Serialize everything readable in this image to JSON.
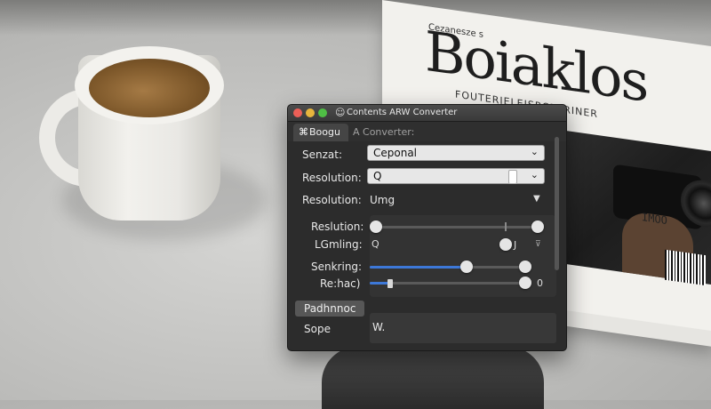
{
  "background": {
    "book": {
      "kicker": "Cezanesze s",
      "title": "Boiaklos",
      "subtitle": "FOUTERIELEISRCEPRINER",
      "side_text": "IMOO"
    }
  },
  "window": {
    "title": "Contents ARW Converter",
    "tabs": [
      {
        "label": "Boogu",
        "icon": "app-icon",
        "active": true
      },
      {
        "label": "A Converter:",
        "active": false
      }
    ],
    "fields": {
      "row1_label": "Senzat:",
      "row1_value": "Ceponal",
      "row2_label": "Resolution:",
      "row2_value": "Q",
      "row3_label": "Resolution:",
      "row3_value": "Umg"
    },
    "group": {
      "row1_label": "Reslution:",
      "row2_label": "LGmling:",
      "row2_value": "Q",
      "row2_suffix": "J",
      "row3_label": "Senkring:",
      "row3_percent": 62,
      "row4_label": "Re:hac)",
      "row4_value": "0"
    },
    "section_button": "Padhnnoc",
    "footer": {
      "label": "Sope",
      "value": "W."
    },
    "colors": {
      "accent": "#3d78d8",
      "window_bg": "#2c2c2c"
    }
  }
}
